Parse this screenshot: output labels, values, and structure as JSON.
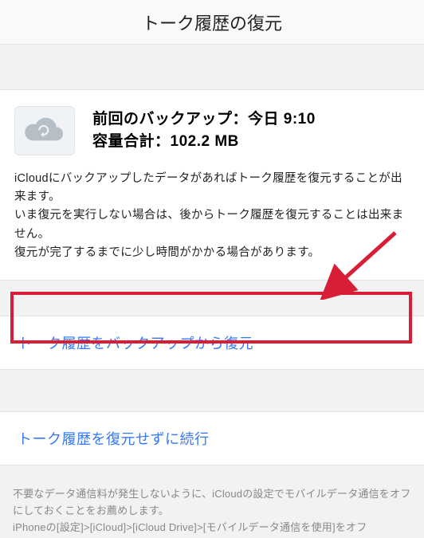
{
  "header": {
    "title": "トーク履歴の復元"
  },
  "info": {
    "line1": "前回のバックアップ：今日 9:10",
    "line2": "容量合計：102.2 MB",
    "desc_l1": "iCloudにバックアップしたデータがあればトーク履歴を復元することが出来ます。",
    "desc_l2": "いま復元を実行しない場合は、後からトーク履歴を復元することは出来ません。",
    "desc_l3": "復元が完了するまでに少し時間がかかる場合があります。"
  },
  "actions": {
    "restore": "トーク履歴をバックアップから復元",
    "skip": "トーク履歴を復元せずに続行"
  },
  "footnote": {
    "l1": "不要なデータ通信料が発生しないように、iCloudの設定でモバイルデータ通信をオフにしておくことをお薦めします。",
    "l2": "iPhoneの[設定]>[iCloud]>[iCloud Drive]>[モバイルデータ通信を使用]をオフ"
  },
  "annotation": {
    "highlight_color": "#d81e36",
    "arrow_color": "#d81e36"
  }
}
